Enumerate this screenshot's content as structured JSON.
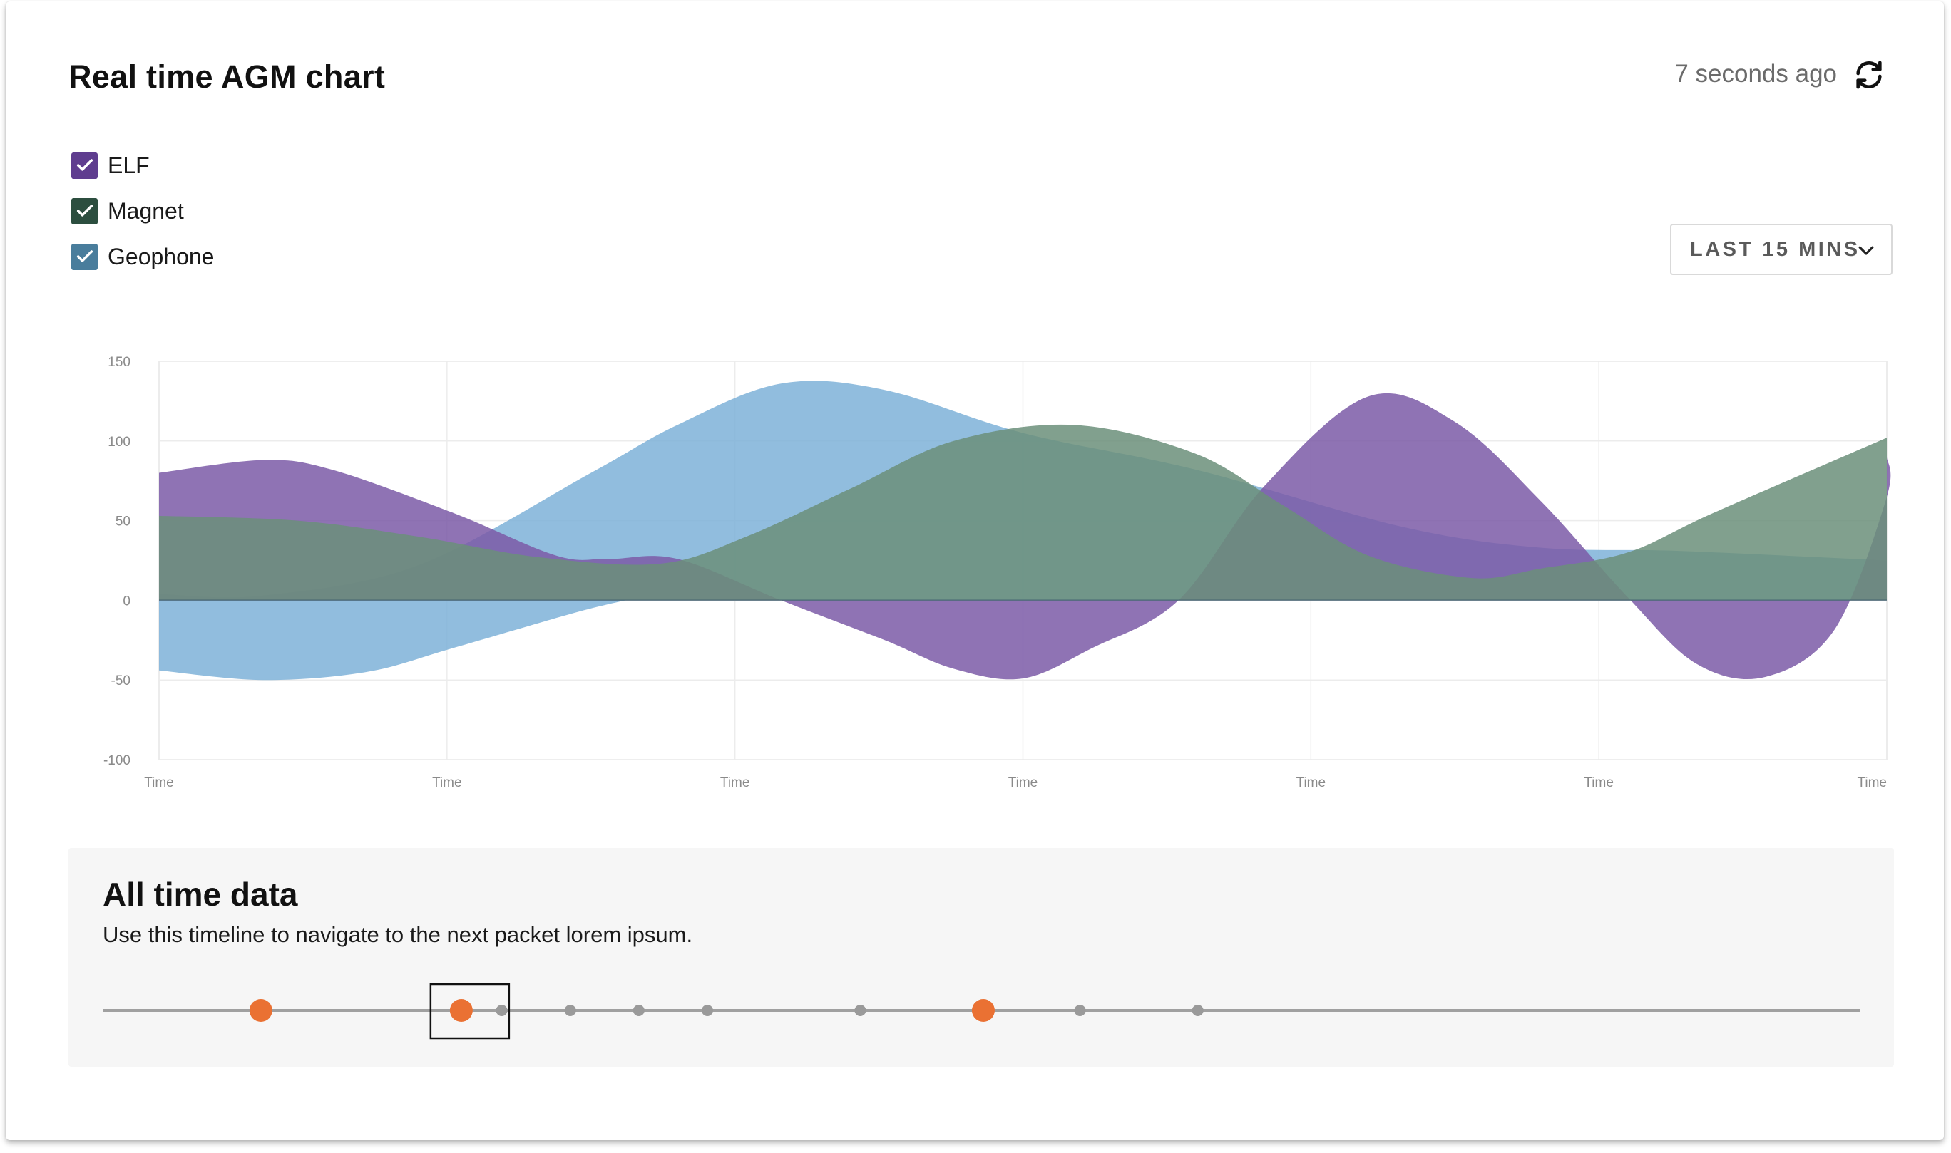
{
  "header": {
    "title": "Real time AGM chart",
    "updated": "7 seconds ago",
    "refresh_icon": "refresh-icon"
  },
  "legend": [
    {
      "label": "ELF",
      "checked": true,
      "color": "#5f3d8f"
    },
    {
      "label": "Magnet",
      "checked": true,
      "color": "#2c4e3f"
    },
    {
      "label": "Geophone",
      "checked": true,
      "color": "#497d9c"
    }
  ],
  "range": {
    "label": "LAST 15 MINS",
    "icon": "chevron-down-icon"
  },
  "chart_data": {
    "type": "area",
    "ylim": [
      -100,
      150
    ],
    "yticks": [
      150,
      100,
      50,
      0,
      -50,
      -100
    ],
    "xtick_labels": [
      "Time",
      "Time",
      "Time",
      "Time",
      "Time",
      "Time",
      "Time"
    ],
    "grid": true,
    "series": [
      {
        "name": "Geophone",
        "color": "#7eb2d8",
        "upper": [
          [
            0,
            4
          ],
          [
            0.06,
            3
          ],
          [
            0.15,
            22
          ],
          [
            0.25,
            80
          ],
          [
            0.3,
            110
          ],
          [
            0.36,
            136
          ],
          [
            0.42,
            132
          ],
          [
            0.5,
            105
          ],
          [
            0.6,
            82
          ],
          [
            0.72,
            46
          ],
          [
            0.8,
            33
          ],
          [
            0.88,
            31
          ],
          [
            1,
            25
          ]
        ],
        "lower": [
          [
            0,
            -44
          ],
          [
            0.06,
            -50
          ],
          [
            0.12,
            -45
          ],
          [
            0.17,
            -30
          ],
          [
            0.24,
            -8
          ],
          [
            0.27,
            0
          ]
        ]
      },
      {
        "name": "ELF",
        "color": "#7b5ba7",
        "upper": [
          [
            0,
            80
          ],
          [
            0.06,
            88
          ],
          [
            0.1,
            82
          ],
          [
            0.17,
            55
          ],
          [
            0.23,
            28
          ],
          [
            0.26,
            26
          ],
          [
            0.3,
            26
          ],
          [
            0.36,
            0
          ],
          [
            0.42,
            -25
          ],
          [
            0.46,
            -43
          ],
          [
            0.5,
            -49
          ],
          [
            0.54,
            -30
          ],
          [
            0.59,
            0
          ],
          [
            0.64,
            72
          ],
          [
            0.7,
            128
          ],
          [
            0.75,
            112
          ],
          [
            0.8,
            62
          ],
          [
            0.85,
            2
          ],
          [
            0.89,
            -40
          ],
          [
            0.93,
            -48
          ],
          [
            0.97,
            -18
          ],
          [
            1,
            65
          ],
          [
            1,
            90
          ]
        ]
      },
      {
        "name": "Magnet",
        "color": "#6b8f7a",
        "upper": [
          [
            0,
            53
          ],
          [
            0.08,
            50
          ],
          [
            0.15,
            40
          ],
          [
            0.22,
            27
          ],
          [
            0.29,
            23
          ],
          [
            0.34,
            40
          ],
          [
            0.4,
            70
          ],
          [
            0.46,
            100
          ],
          [
            0.53,
            110
          ],
          [
            0.6,
            92
          ],
          [
            0.65,
            60
          ],
          [
            0.7,
            28
          ],
          [
            0.76,
            14
          ],
          [
            0.8,
            20
          ],
          [
            0.85,
            30
          ],
          [
            0.9,
            55
          ],
          [
            1,
            102
          ]
        ]
      }
    ]
  },
  "timeline_section": {
    "title": "All time data",
    "description": "Use this timeline to navigate to the next packet lorem ipsum.",
    "points": [
      {
        "pos": 0.09,
        "type": "major"
      },
      {
        "pos": 0.204,
        "type": "major",
        "selected": true
      },
      {
        "pos": 0.227,
        "type": "minor"
      },
      {
        "pos": 0.266,
        "type": "minor"
      },
      {
        "pos": 0.305,
        "type": "minor"
      },
      {
        "pos": 0.344,
        "type": "minor"
      },
      {
        "pos": 0.431,
        "type": "minor"
      },
      {
        "pos": 0.501,
        "type": "major"
      },
      {
        "pos": 0.556,
        "type": "minor"
      },
      {
        "pos": 0.623,
        "type": "minor"
      }
    ],
    "colors": {
      "major": "#ea7133",
      "minor": "#9a9a9a",
      "line": "#a0a0a0"
    }
  }
}
